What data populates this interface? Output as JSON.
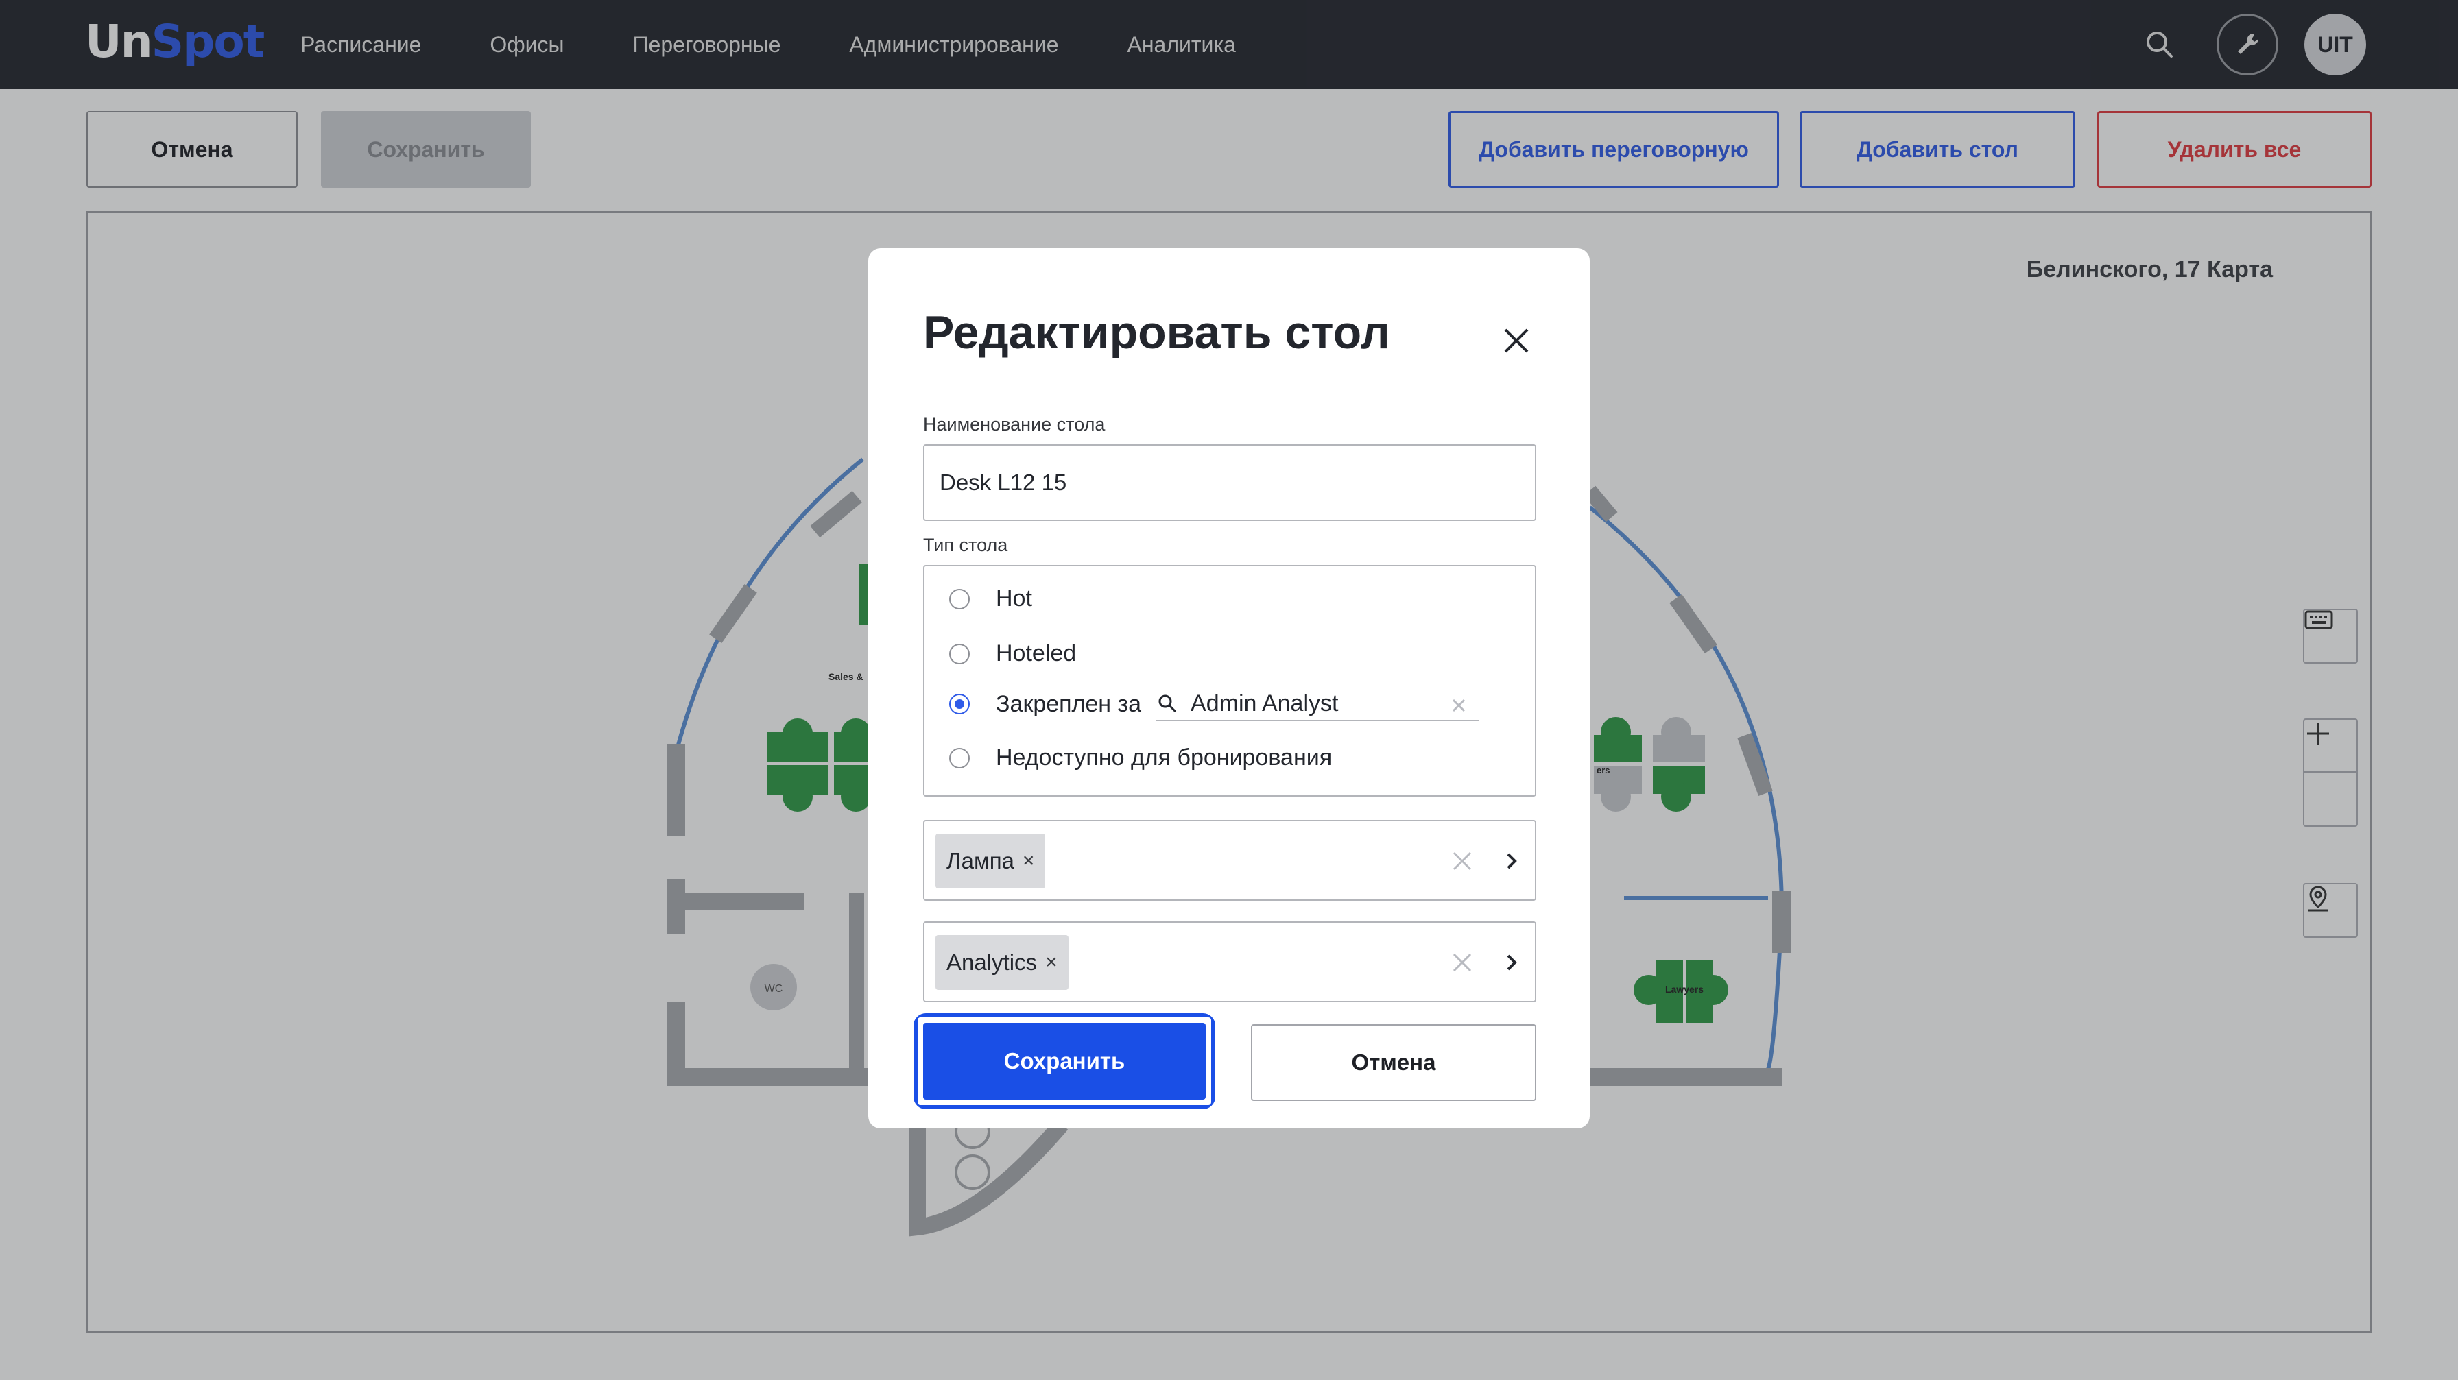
{
  "app": {
    "logo_part1": "Un",
    "logo_part2": "Spot"
  },
  "nav": {
    "items": [
      {
        "label": "Расписание"
      },
      {
        "label": "Офисы"
      },
      {
        "label": "Переговорные"
      },
      {
        "label": "Администрирование"
      },
      {
        "label": "Аналитика"
      }
    ],
    "search_icon": "search-icon",
    "tool_icon": "wrench-icon",
    "avatar_initials": "UIT"
  },
  "toolbar": {
    "cancel_label": "Отмена",
    "save_label": "Сохранить",
    "add_room_label": "Добавить переговорную",
    "add_desk_label": "Добавить стол",
    "delete_all_label": "Удалить все"
  },
  "map": {
    "title": "Белинского, 17 Карта",
    "labels": {
      "sales": "Sales &",
      "wc": "WC",
      "others": "ers",
      "lawyers": "Lawyers"
    },
    "controls": {
      "keyboard_icon": "keyboard-icon",
      "zoom_in_icon": "plus-icon",
      "zoom_out_icon": "minus-icon",
      "locate_icon": "map-pin-icon"
    }
  },
  "modal": {
    "title": "Редактировать стол",
    "name_label": "Наименование стола",
    "name_value": "Desk L12 15",
    "type_label": "Тип стола",
    "types": [
      {
        "label": "Hot",
        "checked": false
      },
      {
        "label": "Hoteled",
        "checked": false
      },
      {
        "label": "Закреплен за",
        "checked": true
      },
      {
        "label": "Недоступно для бронирования",
        "checked": false
      }
    ],
    "assignee": "Admin Analyst",
    "equipment_chip": "Лампа",
    "group_chip": "Analytics",
    "save_label": "Сохранить",
    "cancel_label": "Отмена"
  },
  "colors": {
    "accent": "#2f5be8",
    "danger": "#e0393e",
    "topbar": "#23262d",
    "desk_green": "#2e9a46"
  }
}
